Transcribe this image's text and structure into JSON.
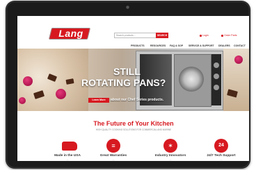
{
  "header": {
    "logo_text": "Lang",
    "search_placeholder": "Search products...",
    "search_button": "SEARCH",
    "login_label": "Login",
    "order_parts_label": "Order Parts"
  },
  "nav": {
    "items": [
      "PRODUCTS",
      "RESOURCES",
      "FAQ & SOP",
      "SERVICE & SUPPORT",
      "DEALERS",
      "CONTACT"
    ]
  },
  "hero": {
    "line1": "STILL",
    "line2": "ROTATING PANS?",
    "cta_label": "Learn More",
    "sub_text": "about our Chef Series products."
  },
  "section": {
    "title": "The Future of Your Kitchen",
    "subtitle": "HIGH QUALITY COOKING SOLUTIONS FOR COMMERCIAL AND MARINE"
  },
  "features": [
    {
      "label": "Made in the USA",
      "icon": "usa-map-icon"
    },
    {
      "label": "Great Warranties",
      "icon": "warranty-icon"
    },
    {
      "label": "Industry Innovators",
      "icon": "lightbulb-icon"
    },
    {
      "label": "24/7 Tech Support",
      "icon": "support-24-icon",
      "glyph": "24"
    }
  ],
  "colors": {
    "brand_red": "#d71920",
    "bezel": "#1b1b1b"
  }
}
